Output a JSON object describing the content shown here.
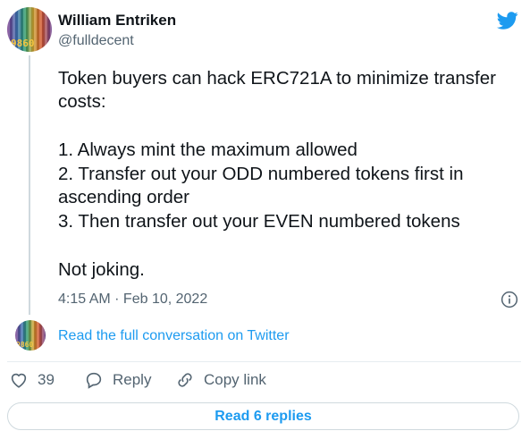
{
  "author": {
    "name": "William Entriken",
    "handle": "@fulldecent",
    "avatar_tag": "9860"
  },
  "tweet": {
    "lines": [
      "Token buyers can hack ERC721A to minimize transfer",
      "costs:",
      "1. Always mint the maximum allowed",
      "2. Transfer out your ODD numbered tokens first in",
      "ascending order",
      "3. Then transfer out your EVEN numbered tokens",
      "Not joking."
    ],
    "timestamp": "4:15 AM · Feb 10, 2022"
  },
  "conversation_link": "Read the full conversation on Twitter",
  "actions": {
    "like_count": "39",
    "reply_label": "Reply",
    "copy_label": "Copy link"
  },
  "read_replies": "Read 6 replies",
  "colors": {
    "accent": "#1d9bf0",
    "muted": "#536471",
    "text": "#0f1419"
  },
  "icons": [
    "twitter-bird-icon",
    "info-icon",
    "heart-icon",
    "reply-icon",
    "link-icon"
  ]
}
